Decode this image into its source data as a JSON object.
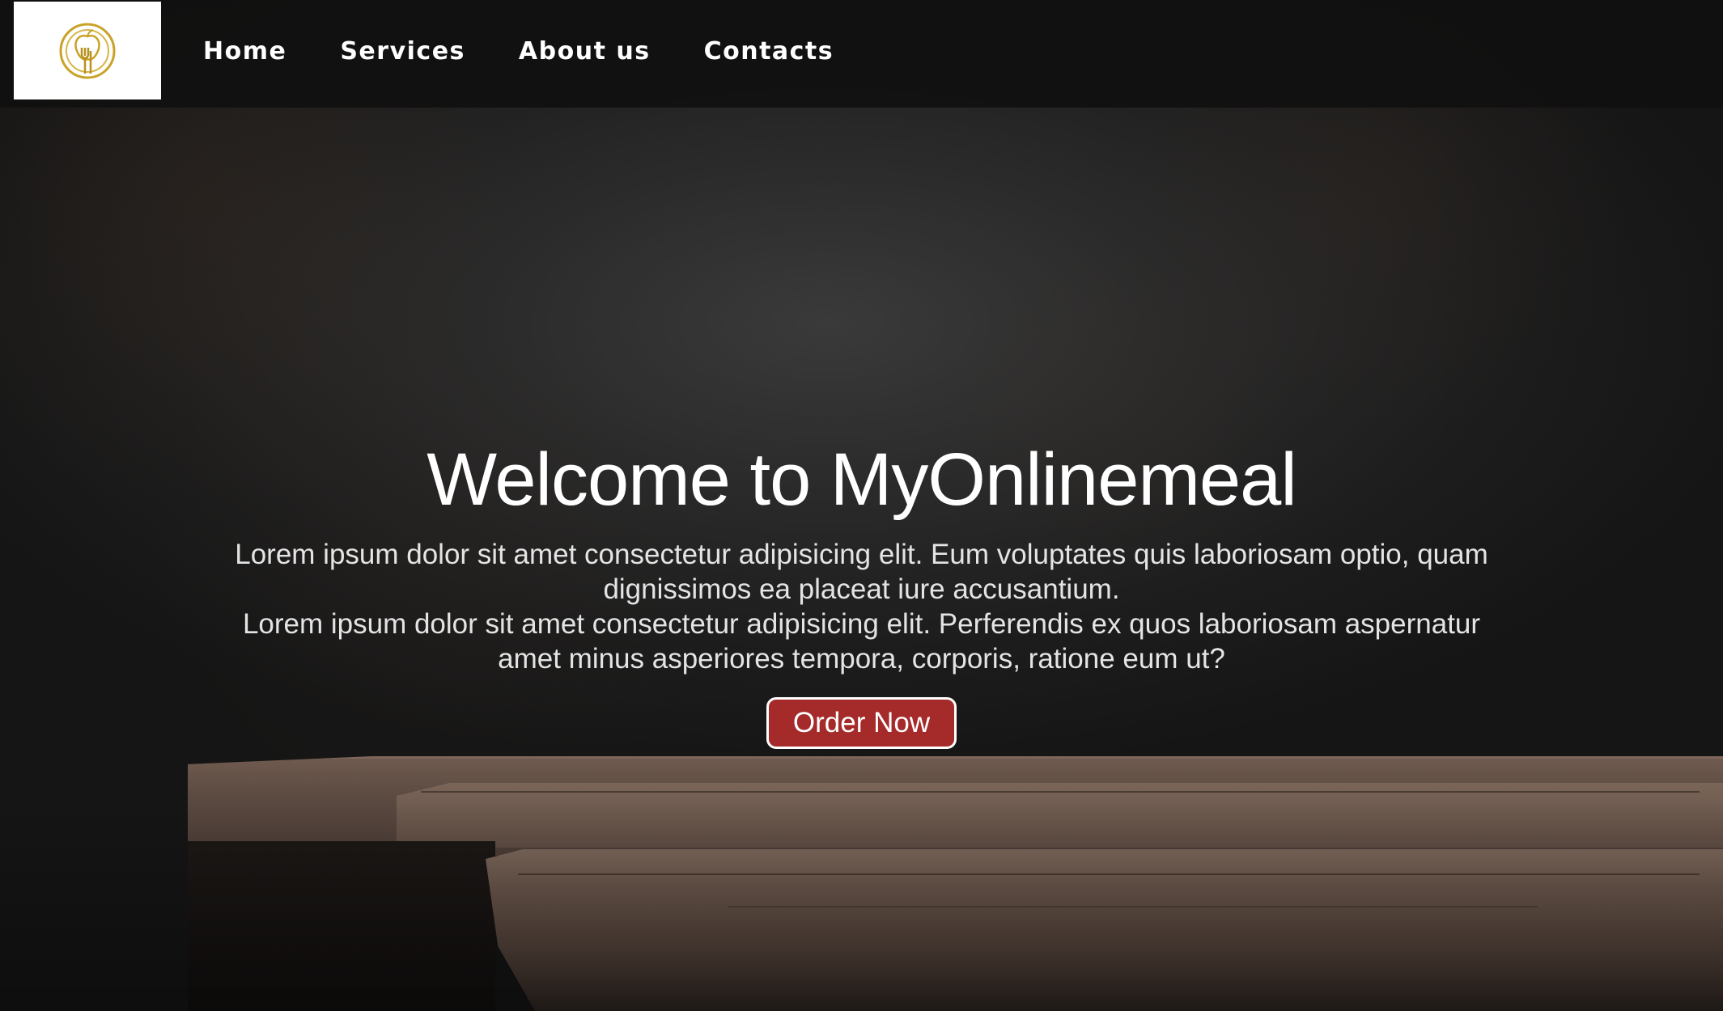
{
  "nav": {
    "logo_icon": "fork-apple-emblem-icon",
    "links": [
      "Home",
      "Services",
      "About us",
      "Contacts"
    ]
  },
  "hero": {
    "title": "Welcome to MyOnlinemeal",
    "paragraph_1": "Lorem ipsum dolor sit amet consectetur adipisicing elit. Eum voluptates quis laboriosam optio, quam dignissimos ea placeat iure accusantium.",
    "paragraph_2": "Lorem ipsum dolor sit amet consectetur adipisicing elit. Perferendis ex quos laboriosam aspernatur amet minus asperiores tempora, corporis, ratione eum ut?",
    "order_button": "Order Now"
  },
  "colors": {
    "navbar_bg": "#101010",
    "button_bg": "#a52a2a",
    "logo_gold": "#c9a227"
  }
}
